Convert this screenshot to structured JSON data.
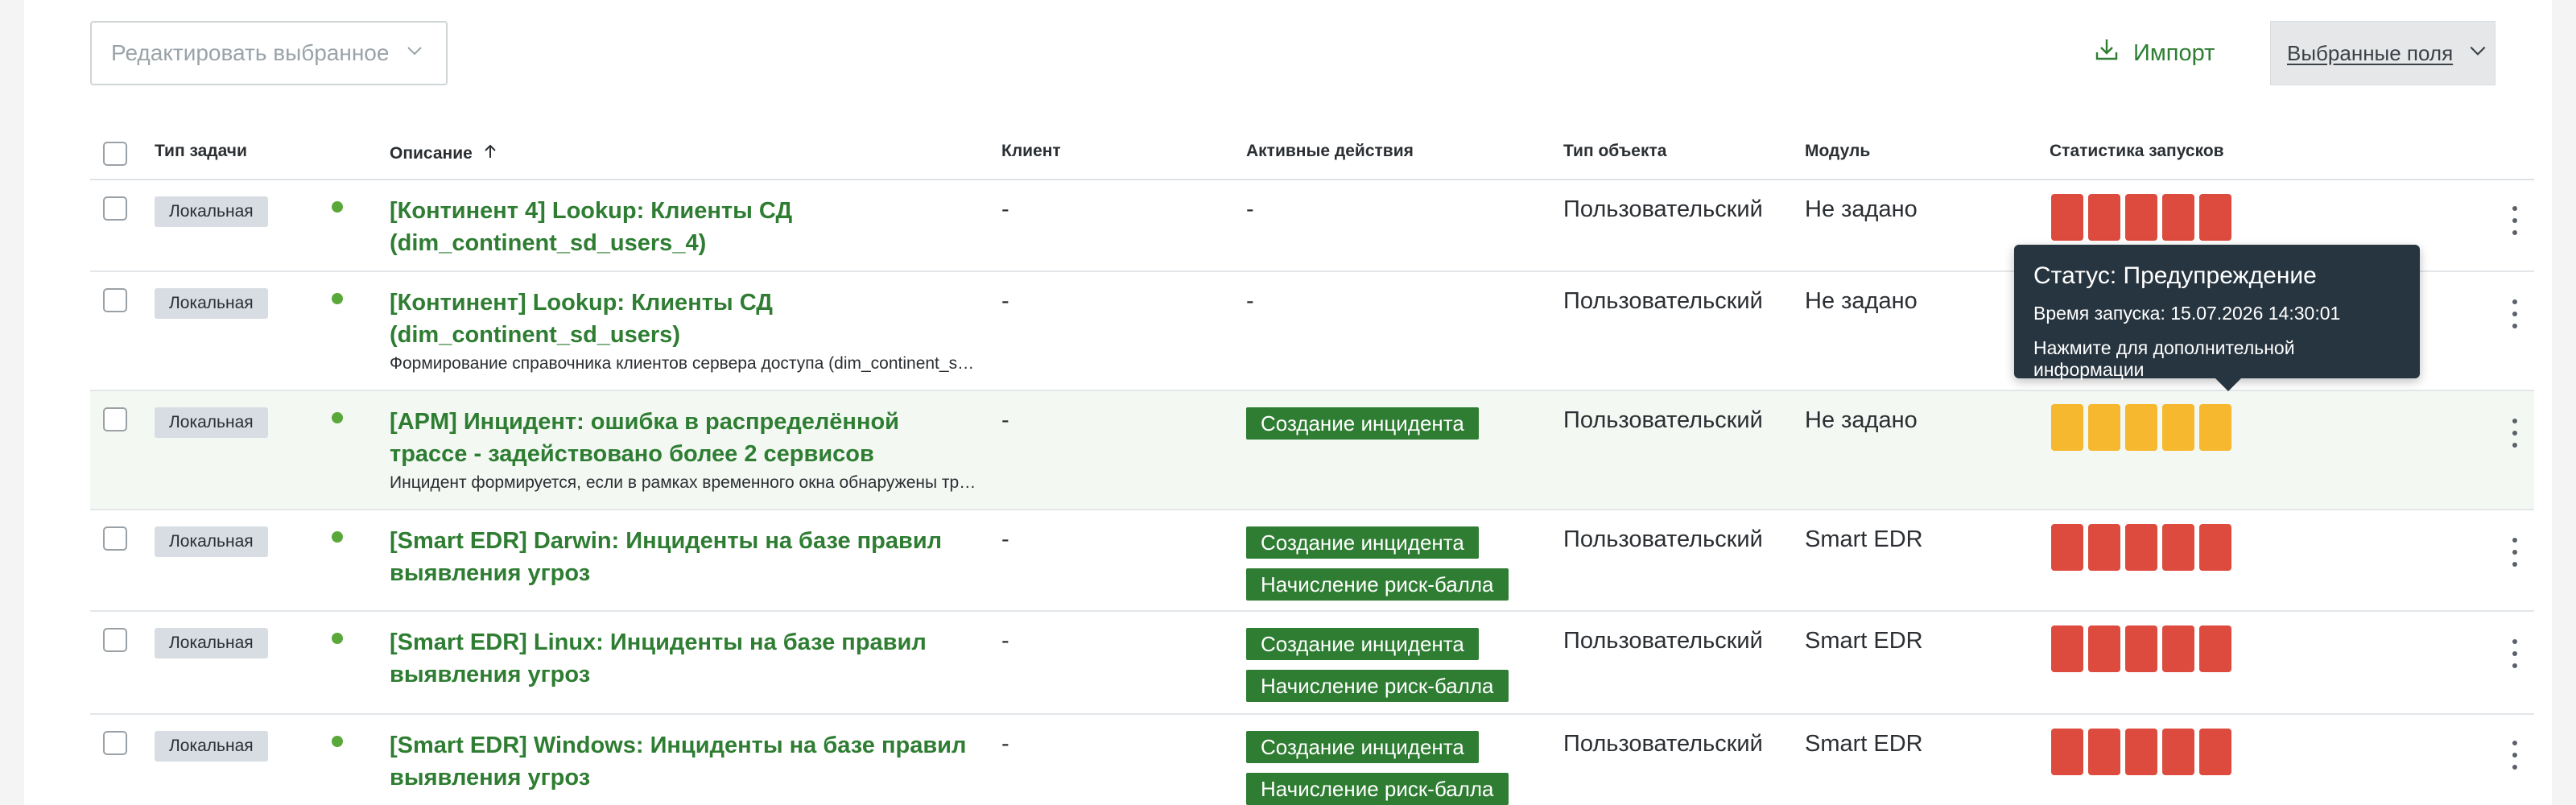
{
  "toolbar": {
    "edit_selected_placeholder": "Редактировать выбранное",
    "import_label": "Импорт",
    "fields_label": "Выбранные поля"
  },
  "table": {
    "headers": {
      "task_type": "Тип задачи",
      "description": "Описание",
      "client": "Клиент",
      "active_actions": "Активные действия",
      "object_type": "Тип объекта",
      "module": "Модуль",
      "run_stats": "Статистика запусков"
    },
    "rows": [
      {
        "type": "Локальная",
        "title": "[Континент 4] Lookup: Клиенты СД (dim_continent_sd_users_4)",
        "description": "",
        "client": "-",
        "actions": [
          "-"
        ],
        "object_type": "Пользовательский",
        "module": "Не задано",
        "stats": [
          "error",
          "error",
          "error",
          "error",
          "error"
        ]
      },
      {
        "type": "Локальная",
        "title": "[Континент] Lookup: Клиенты СД (dim_continent_sd_users)",
        "description": "Формирование справочника клиентов сервера доступа (dim_continent_sd_users)",
        "client": "-",
        "actions": [
          "-"
        ],
        "object_type": "Пользовательский",
        "module": "Не задано",
        "stats": [
          "error",
          "error",
          "error",
          "error",
          "error"
        ]
      },
      {
        "type": "Локальная",
        "title": "[APM] Инцидент: ошибка в распределённой трассе - задействовано более 2 сервисов",
        "description": "Инцидент формируется, если в рамках временного окна обнаружены трассы с ошибками",
        "client": "-",
        "actions": [
          "Создание инцидента"
        ],
        "object_type": "Пользовательский",
        "module": "Не задано",
        "stats": [
          "warning",
          "warning",
          "warning",
          "warning",
          "warning"
        ]
      },
      {
        "type": "Локальная",
        "title": "[Smart EDR] Darwin: Инциденты на базе правил выявления угроз",
        "description": "",
        "client": "-",
        "actions": [
          "Создание инцидента",
          "Начисление риск-балла"
        ],
        "object_type": "Пользовательский",
        "module": "Smart EDR",
        "stats": [
          "error",
          "error",
          "error",
          "error",
          "error"
        ]
      },
      {
        "type": "Локальная",
        "title": "[Smart EDR] Linux: Инциденты на базе правил выявления угроз",
        "description": "",
        "client": "-",
        "actions": [
          "Создание инцидента",
          "Начисление риск-балла"
        ],
        "object_type": "Пользовательский",
        "module": "Smart EDR",
        "stats": [
          "error",
          "error",
          "error",
          "error",
          "error"
        ]
      },
      {
        "type": "Локальная",
        "title": "[Smart EDR] Windows: Инциденты на базе правил выявления угроз",
        "description": "",
        "client": "-",
        "actions": [
          "Создание инцидента",
          "Начисление риск-балла"
        ],
        "object_type": "Пользовательский",
        "module": "Smart EDR",
        "stats": [
          "error",
          "error",
          "error",
          "error",
          "error"
        ]
      }
    ]
  },
  "tooltip": {
    "status": "Статус: Предупреждение",
    "run_time": "Время запуска: 15.07.2026 14:30:01",
    "hint": "Нажмите для дополнительной информации"
  },
  "colors": {
    "accent_green": "#2e7d32",
    "status_error": "#dd4b3e",
    "status_warning": "#f5b82e",
    "tooltip_bg": "#273540"
  },
  "icons": {
    "edit_select": "chevron-down-icon",
    "import": "import-icon",
    "fields": "chevron-down-icon",
    "sort": "arrow-up-icon",
    "row_menu": "more-vertical-icon"
  }
}
